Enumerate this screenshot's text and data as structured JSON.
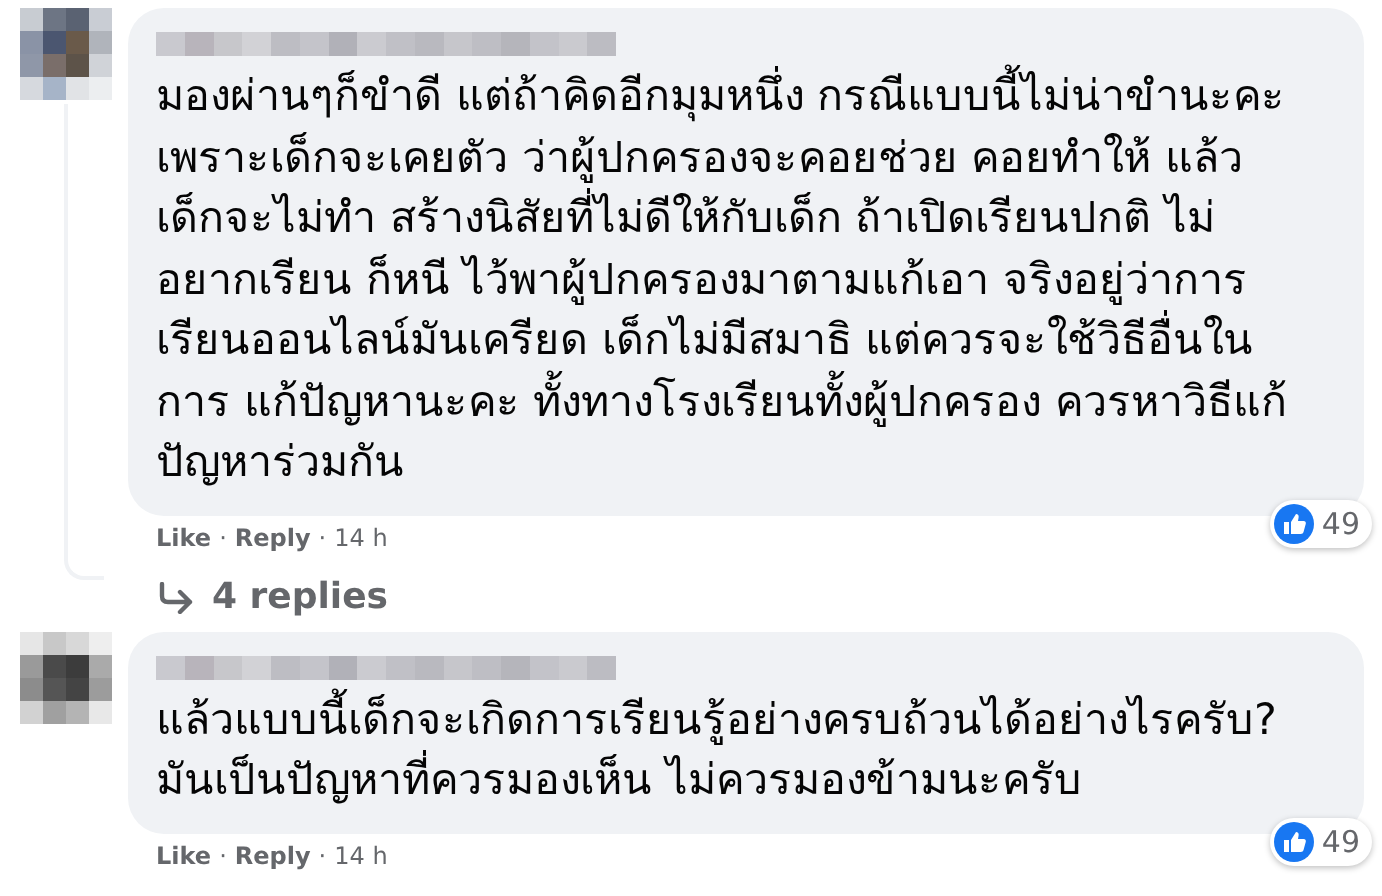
{
  "comments": [
    {
      "text": "มองผ่านๆก็ขำดี แต่ถ้าคิดอีกมุมหนึ่ง กรณีแบบนี้ไม่น่าขำนะคะ เพราะเด็กจะเคยตัว ว่าผู้ปกครองจะคอยช่วย คอยทำให้ แล้ว เด็กจะไม่ทำ สร้างนิสัยที่ไม่ดีให้กับเด็ก ถ้าเปิดเรียนปกติ ไม่ อยากเรียน ก็หนี ไว้พาผู้ปกครองมาตามแก้เอา จริงอยู่ว่าการ เรียนออนไลน์มันเครียด เด็กไม่มีสมาธิ แต่ควรจะใช้วิธีอื่นในการ แก้ปัญหานะคะ ทั้งทางโรงเรียนทั้งผู้ปกครอง ควรหาวิธีแก้ ปัญหาร่วมกัน",
      "like": "Like",
      "reply": "Reply",
      "separator": "·",
      "time": "14 h",
      "reactions": "49",
      "replies": "4 replies"
    },
    {
      "text": "แล้วแบบนี้เด็กจะเกิดการเรียนรู้อย่างครบถ้วนได้อย่างไรครับ? มันเป็นปัญหาที่ควรมองเห็น ไม่ควรมองข้ามนะครับ",
      "like": "Like",
      "reply": "Reply",
      "separator": "·",
      "time": "14 h",
      "reactions": "49"
    }
  ]
}
